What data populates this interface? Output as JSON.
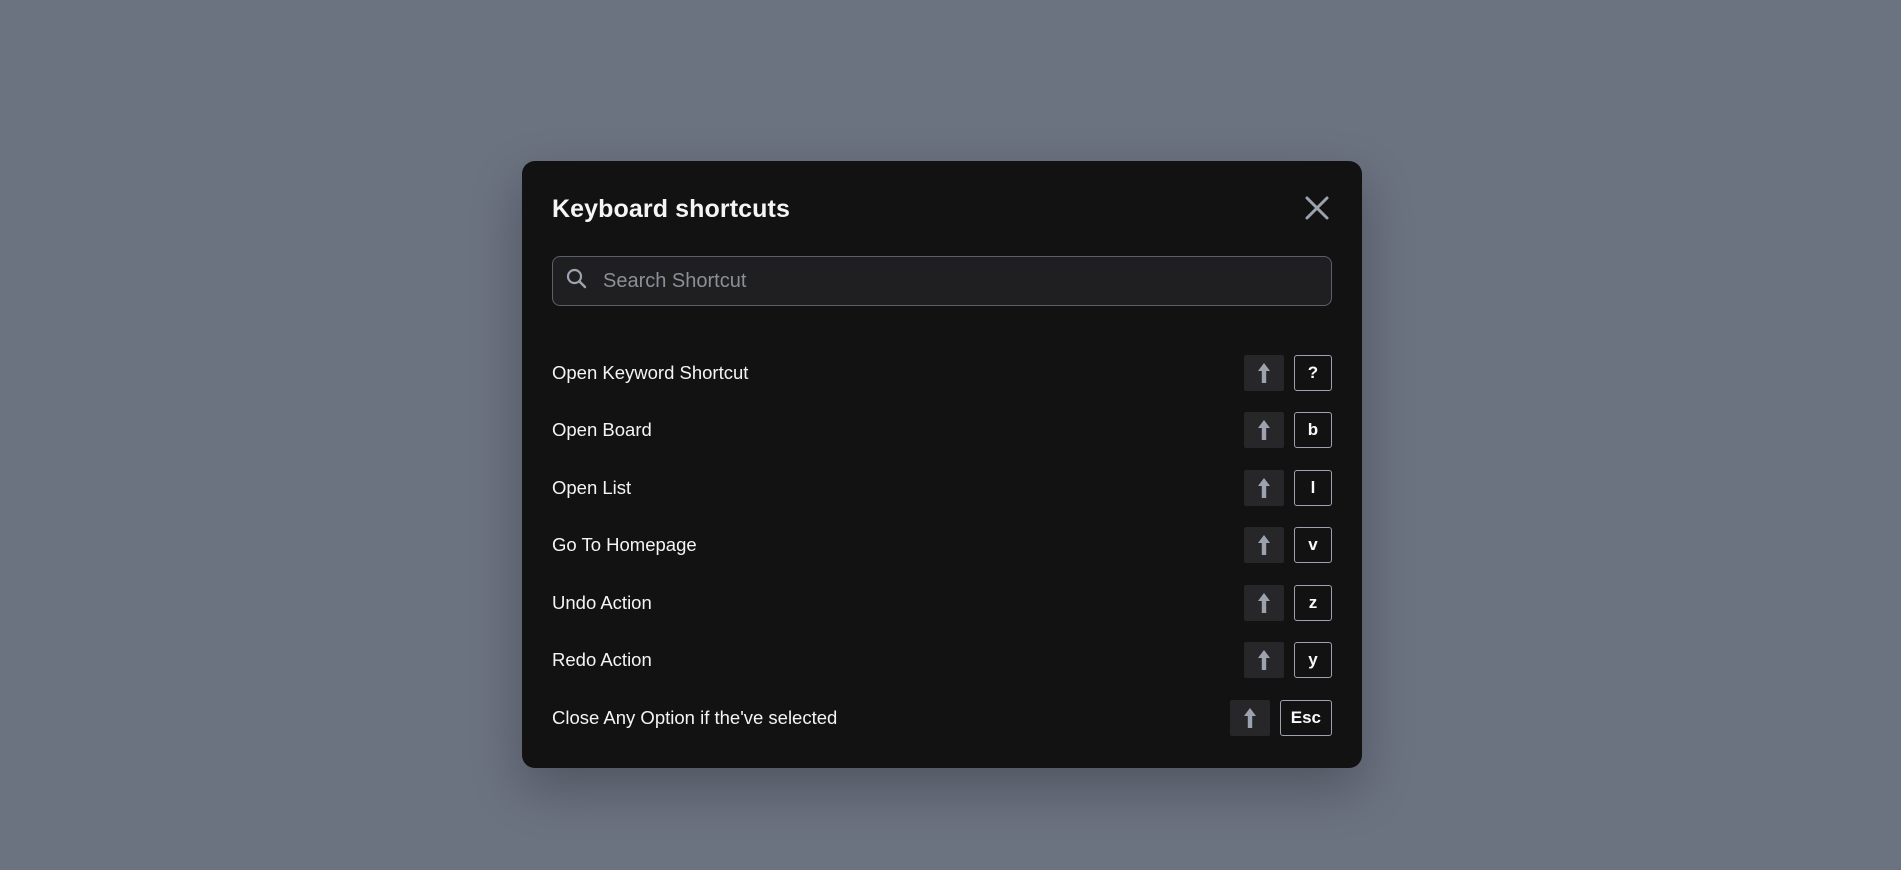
{
  "modal": {
    "title": "Keyboard shortcuts",
    "close_icon": "close-icon"
  },
  "search": {
    "placeholder": "Search Shortcut",
    "value": "",
    "icon": "search-icon"
  },
  "shortcuts": [
    {
      "label": "Open Keyword Shortcut",
      "modifier_icon": "arrow-up-icon",
      "key": "?"
    },
    {
      "label": "Open Board",
      "modifier_icon": "arrow-up-icon",
      "key": "b"
    },
    {
      "label": "Open List",
      "modifier_icon": "arrow-up-icon",
      "key": "l"
    },
    {
      "label": "Go To Homepage",
      "modifier_icon": "arrow-up-icon",
      "key": "v"
    },
    {
      "label": "Undo Action",
      "modifier_icon": "arrow-up-icon",
      "key": "z"
    },
    {
      "label": "Redo Action",
      "modifier_icon": "arrow-up-icon",
      "key": "y"
    },
    {
      "label": "Close Any Option if the've selected",
      "modifier_icon": "arrow-up-icon",
      "key": "Esc"
    }
  ],
  "colors": {
    "backdrop": "#6b7280",
    "modal_bg": "#121212",
    "text": "#f3f4f6",
    "muted_icon": "#9ca3af"
  }
}
